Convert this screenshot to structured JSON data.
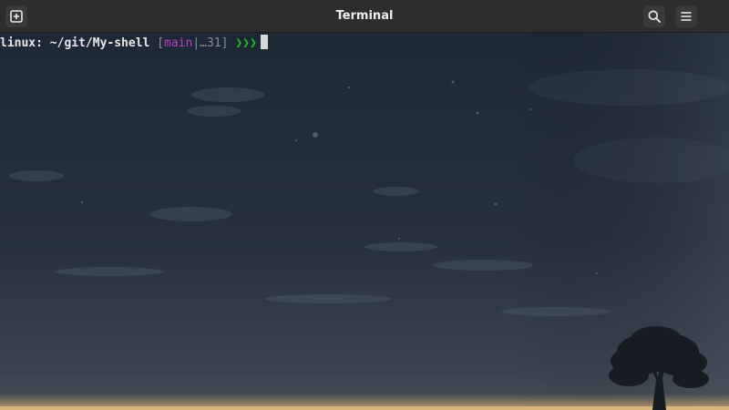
{
  "window": {
    "title": "Terminal",
    "icons": {
      "new_tab": "new-tab-icon",
      "search": "search-icon",
      "menu": "hamburger-menu-icon"
    }
  },
  "prompt": {
    "path": "linux: ~/git/My-shell",
    "bracket_open": "[",
    "branch": "main",
    "divider": "|",
    "status": "…31",
    "bracket_close": "]",
    "symbol": "❯❯❯"
  },
  "colors": {
    "header_bg": "#2d2d2d",
    "branch": "#c040c0",
    "prompt_symbol": "#22c322",
    "sky_top": "#1d2836",
    "sky_bottom": "#3a4450"
  }
}
